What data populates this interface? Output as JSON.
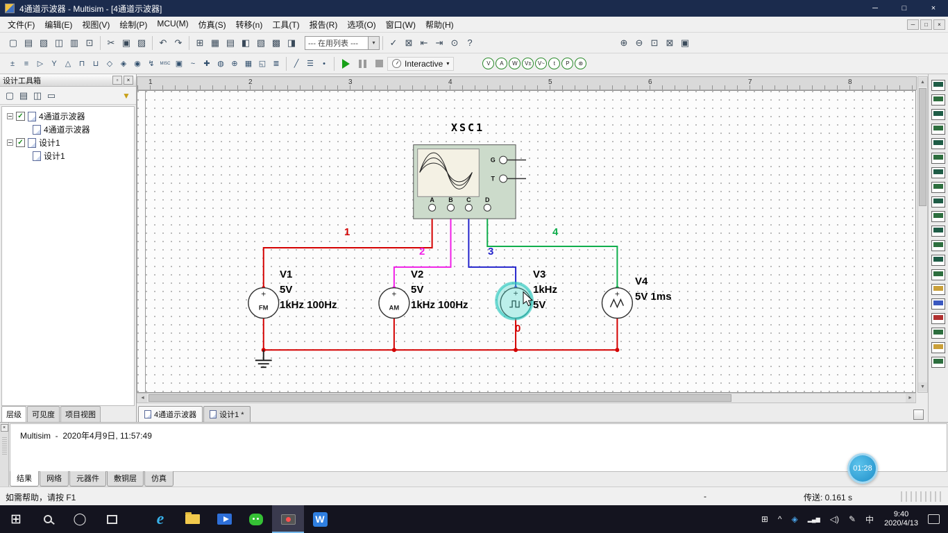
{
  "window": {
    "title": "4通道示波器 - Multisim - [4通道示波器]",
    "minimize_glyph": "─",
    "maximize_glyph": "□",
    "close_glyph": "×"
  },
  "menubar": {
    "items": [
      {
        "name": "menu-file",
        "label": "文件(F)"
      },
      {
        "name": "menu-edit",
        "label": "编辑(E)"
      },
      {
        "name": "menu-view",
        "label": "视图(V)"
      },
      {
        "name": "menu-place",
        "label": "绘制(P)"
      },
      {
        "name": "menu-mcu",
        "label": "MCU(M)"
      },
      {
        "name": "menu-simulate",
        "label": "仿真(S)"
      },
      {
        "name": "menu-transfer",
        "label": "转移(n)"
      },
      {
        "name": "menu-tools",
        "label": "工具(T)"
      },
      {
        "name": "menu-reports",
        "label": "报告(R)"
      },
      {
        "name": "menu-options",
        "label": "选项(O)"
      },
      {
        "name": "menu-window",
        "label": "窗口(W)"
      },
      {
        "name": "menu-help",
        "label": "帮助(H)"
      }
    ],
    "mdi_minimize_glyph": "─",
    "mdi_restore_glyph": "□",
    "mdi_close_glyph": "×"
  },
  "toolbar1": {
    "file_icons": [
      {
        "name": "new-file-icon",
        "glyph": "▢"
      },
      {
        "name": "open-file-icon",
        "glyph": "▤"
      },
      {
        "name": "open-sample-icon",
        "glyph": "▧"
      },
      {
        "name": "save-icon",
        "glyph": "◫"
      },
      {
        "name": "print-icon",
        "glyph": "▥"
      },
      {
        "name": "print-preview-icon",
        "glyph": "⊡"
      }
    ],
    "edit_icons": [
      {
        "name": "cut-icon",
        "glyph": "✂"
      },
      {
        "name": "copy-icon",
        "glyph": "▣"
      },
      {
        "name": "paste-icon",
        "glyph": "▨"
      }
    ],
    "history_icons": [
      {
        "name": "undo-icon",
        "glyph": "↶"
      },
      {
        "name": "redo-icon",
        "glyph": "↷"
      }
    ],
    "view_icons": [
      {
        "name": "toggle-grid-icon",
        "glyph": "⊞"
      },
      {
        "name": "spreadsheet-view-icon",
        "glyph": "▦"
      },
      {
        "name": "database-manager-icon",
        "glyph": "▤"
      },
      {
        "name": "component-wizard-icon",
        "glyph": "◧"
      },
      {
        "name": "grapher-icon",
        "glyph": "▧"
      },
      {
        "name": "postprocessor-icon",
        "glyph": "▩"
      },
      {
        "name": "parent-sheet-icon",
        "glyph": "◨"
      }
    ],
    "in_use_list": {
      "value": "--- 在用列表 ---",
      "arrow": "▾"
    },
    "tool_icons": [
      {
        "name": "erc-check-icon",
        "glyph": "✓"
      },
      {
        "name": "capture-area-icon",
        "glyph": "⊠"
      },
      {
        "name": "back-annotate-icon",
        "glyph": "⇤"
      },
      {
        "name": "forward-annotate-icon",
        "glyph": "⇥"
      },
      {
        "name": "find-icon",
        "glyph": "⊙"
      },
      {
        "name": "help-icon",
        "glyph": "?"
      }
    ],
    "zoom_icons": [
      {
        "name": "zoom-in-icon",
        "glyph": "⊕"
      },
      {
        "name": "zoom-out-icon",
        "glyph": "⊖"
      },
      {
        "name": "zoom-area-icon",
        "glyph": "⊡"
      },
      {
        "name": "zoom-fit-icon",
        "glyph": "⊠"
      },
      {
        "name": "fullscreen-icon",
        "glyph": "▣"
      }
    ]
  },
  "toolbar2": {
    "component_icons": [
      {
        "name": "place-source-icon",
        "glyph": "±"
      },
      {
        "name": "place-basic-icon",
        "glyph": "≡"
      },
      {
        "name": "place-diode-icon",
        "glyph": "▷"
      },
      {
        "name": "place-transistor-icon",
        "glyph": "Y"
      },
      {
        "name": "place-analog-icon",
        "glyph": "△"
      },
      {
        "name": "place-ttl-icon",
        "glyph": "⊓"
      },
      {
        "name": "place-cmos-icon",
        "glyph": "⊔"
      },
      {
        "name": "place-misc-digital-icon",
        "glyph": "◇"
      },
      {
        "name": "place-mixed-icon",
        "glyph": "◈"
      },
      {
        "name": "place-indicator-icon",
        "glyph": "◉"
      },
      {
        "name": "place-power-icon",
        "glyph": "↯"
      },
      {
        "name": "place-misc-icon",
        "glyph": "MISC",
        "cls": "tiny"
      },
      {
        "name": "place-advanced-peripherals-icon",
        "glyph": "▣"
      },
      {
        "name": "place-rf-icon",
        "glyph": "~"
      },
      {
        "name": "place-electromechanical-icon",
        "glyph": "✚"
      },
      {
        "name": "place-ni-component-icon",
        "glyph": "◍"
      },
      {
        "name": "place-connector-icon",
        "glyph": "⊕"
      },
      {
        "name": "place-mcu-icon",
        "glyph": "▦"
      },
      {
        "name": "place-hierarchical-block-icon",
        "glyph": "◱"
      },
      {
        "name": "place-bus-icon",
        "glyph": "≣"
      }
    ],
    "wire_icons": [
      {
        "name": "wire-mode-icon",
        "glyph": "╱"
      },
      {
        "name": "bus-mode-icon",
        "glyph": "☰"
      },
      {
        "name": "junction-icon",
        "glyph": "•"
      }
    ],
    "interactive_label": "Interactive",
    "interactive_arrow": "▾",
    "probe_icons": [
      {
        "name": "probe-voltage-icon",
        "glyph": "V"
      },
      {
        "name": "probe-current-icon",
        "glyph": "A"
      },
      {
        "name": "probe-power-icon",
        "glyph": "W"
      },
      {
        "name": "probe-differential-voltage-icon",
        "glyph": "V±"
      },
      {
        "name": "probe-voltage-rms-icon",
        "glyph": "V~"
      },
      {
        "name": "probe-instantaneous-icon",
        "glyph": "t"
      },
      {
        "name": "probe-periodic-icon",
        "glyph": "P"
      },
      {
        "name": "probe-settings-icon",
        "glyph": "⊛"
      }
    ]
  },
  "design_toolbox": {
    "title": "设计工具箱",
    "float_glyph": "▫",
    "close_glyph": "×",
    "toolbar_icons": [
      {
        "name": "toolbox-new-icon",
        "glyph": "▢"
      },
      {
        "name": "toolbox-open-icon",
        "glyph": "▤"
      },
      {
        "name": "toolbox-save-icon",
        "glyph": "◫"
      },
      {
        "name": "toolbox-close-file-icon",
        "glyph": "▭"
      }
    ],
    "filter_glyph": "▼",
    "checked_glyph": "✓",
    "tree": [
      {
        "label": "4通道示波器"
      },
      {
        "label": "4通道示波器"
      },
      {
        "label": "设计1"
      },
      {
        "label": "设计1"
      }
    ],
    "tabs": [
      {
        "label": "层级",
        "cls": "active"
      },
      {
        "label": "可见度"
      },
      {
        "label": "项目视图"
      }
    ]
  },
  "canvas": {
    "ruler_marks": [
      {
        "n": "1"
      },
      {
        "n": "2"
      },
      {
        "n": "3"
      },
      {
        "n": "4"
      },
      {
        "n": "5"
      },
      {
        "n": "6"
      },
      {
        "n": "7"
      },
      {
        "n": "8"
      }
    ],
    "scrollbars": {
      "up": "▲",
      "down": "▼",
      "left": "◄",
      "right": "►"
    },
    "circuit": {
      "scope": {
        "ref": "XSC1",
        "side_terminals": [
          {
            "t": "G"
          },
          {
            "t": "T"
          }
        ],
        "bottom_terminals": [
          {
            "t": "A"
          },
          {
            "t": "B"
          },
          {
            "t": "C"
          },
          {
            "t": "D"
          }
        ]
      },
      "polarity_glyph": "+",
      "sources": [
        {
          "ref": "V1",
          "symbol": "FM",
          "lines": [
            "V1",
            "5V",
            "1kHz 100Hz"
          ]
        },
        {
          "ref": "V2",
          "symbol": "AM",
          "lines": [
            "V2",
            "5V",
            "1kHz 100Hz"
          ]
        },
        {
          "ref": "V3",
          "symbol": "square-wave",
          "lines": [
            "V3",
            "1kHz",
            "5V"
          ]
        },
        {
          "ref": "V4",
          "symbol": "triangle-wave",
          "lines": [
            "V4",
            "5V 1ms"
          ]
        }
      ],
      "net_labels": [
        {
          "n": "1",
          "color": "#d40000"
        },
        {
          "n": "2",
          "color": "#f01ee6"
        },
        {
          "n": "3",
          "color": "#2424cc"
        },
        {
          "n": "4",
          "color": "#0fae4c"
        },
        {
          "n": "0",
          "color": "#d40000"
        }
      ],
      "wire_colors": {
        "channel_a": "#d40000",
        "channel_b": "#f01ee6",
        "channel_c": "#2424cc",
        "channel_d": "#0fae4c",
        "ground_net": "#d40000"
      }
    }
  },
  "sheet_tabs": [
    {
      "label": "4通道示波器",
      "cls": "active"
    },
    {
      "label": "设计1 *"
    }
  ],
  "instruments": [
    {
      "name": "multimeter-icon"
    },
    {
      "name": "function-generator-icon"
    },
    {
      "name": "wattmeter-icon"
    },
    {
      "name": "oscilloscope-icon"
    },
    {
      "name": "four-channel-oscilloscope-icon"
    },
    {
      "name": "bode-plotter-icon"
    },
    {
      "name": "frequency-counter-icon"
    },
    {
      "name": "word-generator-icon"
    },
    {
      "name": "logic-converter-icon"
    },
    {
      "name": "logic-analyzer-icon"
    },
    {
      "name": "iv-analyzer-icon"
    },
    {
      "name": "distortion-analyzer-icon"
    },
    {
      "name": "spectrum-analyzer-icon"
    },
    {
      "name": "network-analyzer-icon"
    },
    {
      "name": "agilent-function-generator-icon"
    },
    {
      "name": "agilent-multimeter-icon"
    },
    {
      "name": "agilent-oscilloscope-icon"
    },
    {
      "name": "tektronix-oscilloscope-icon"
    },
    {
      "name": "labview-instrument-icon"
    },
    {
      "name": "current-probe-icon"
    }
  ],
  "results_panel": {
    "close_glyph": "×",
    "message": "Multisim  -  2020年4月9日, 11:57:49",
    "tabs": [
      {
        "label": "结果",
        "cls": "active"
      },
      {
        "label": "网络"
      },
      {
        "label": "元器件"
      },
      {
        "label": "敷铜层"
      },
      {
        "label": "仿真"
      }
    ]
  },
  "statusbar": {
    "help_text": "如需帮助，请按 F1",
    "dash": "-",
    "transfer_text": "传送: 0.161 s"
  },
  "taskbar": {
    "apps": [
      {
        "name": "start-button",
        "cls": "start",
        "glyph": "⊞"
      },
      {
        "name": "search-button",
        "cls": "search",
        "glyph": ""
      },
      {
        "name": "cortana-button",
        "cls": "cortana",
        "glyph": "◯"
      },
      {
        "name": "task-view-button",
        "cls": "taskview",
        "glyph": ""
      },
      {
        "name": "edge-browser-icon",
        "cls": "edge",
        "glyph": "e"
      },
      {
        "name": "file-explorer-icon",
        "cls": "folder",
        "glyph": ""
      },
      {
        "name": "video-app-icon",
        "cls": "video",
        "glyph": ""
      },
      {
        "name": "wechat-icon",
        "cls": "wechat",
        "glyph": ""
      },
      {
        "name": "screen-recorder-icon",
        "cls": "recorder active",
        "glyph": ""
      },
      {
        "name": "wps-icon",
        "cls": "wps",
        "glyph": "W"
      }
    ],
    "tray": [
      {
        "name": "tray-grid-icon",
        "glyph": "⊞"
      },
      {
        "name": "hidden-icons-chevron",
        "glyph": "^"
      },
      {
        "name": "security-icon",
        "cls": "blue",
        "glyph": "◈"
      },
      {
        "name": "network-icon",
        "cls": "net",
        "glyph": "▂▄▆"
      },
      {
        "name": "volume-icon",
        "glyph": "◁)"
      },
      {
        "name": "pen-icon",
        "glyph": "✎"
      },
      {
        "name": "ime-icon",
        "glyph": "中"
      }
    ],
    "clock": {
      "time": "9:40",
      "date": "2020/4/13"
    }
  },
  "recorder_overlay": {
    "time": "01:28"
  }
}
